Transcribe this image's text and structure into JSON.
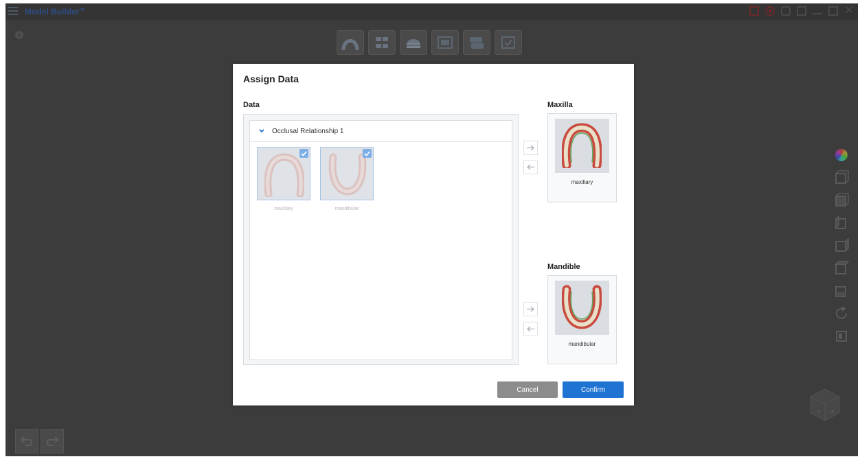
{
  "app": {
    "title": "Model Builder",
    "title_sup": "m"
  },
  "dialog": {
    "title": "Assign Data",
    "data_label": "Data",
    "maxilla_label": "Maxilla",
    "mandible_label": "Mandible",
    "group": {
      "label": "Occlusal Relationship 1",
      "icon": "chevron-down-icon"
    },
    "items": [
      {
        "caption": "maxillary",
        "checked": true,
        "icon": "maxillary-scan-icon"
      },
      {
        "caption": "mandibular",
        "checked": true,
        "icon": "mandibular-scan-icon"
      }
    ],
    "maxilla_slot": {
      "caption": "maxillary"
    },
    "mandible_slot": {
      "caption": "mandibular"
    },
    "cancel_label": "Cancel",
    "confirm_label": "Confirm"
  },
  "colors": {
    "accent": "#1f73d3",
    "cancel": "#8c8c8c",
    "background": "#3c3c3c",
    "check": "#7eaee8"
  },
  "window_controls": [
    "record-area-icon",
    "record-icon",
    "screenshot-icon",
    "copy-icon",
    "minimize-icon",
    "restore-icon",
    "close-icon"
  ],
  "right_toolbar": [
    "color-wheel-icon",
    "view-front-icon",
    "view-back-icon",
    "view-left-icon",
    "view-right-icon",
    "view-top-icon",
    "view-bottom-icon",
    "reset-view-icon",
    "toggle-panel-icon"
  ]
}
